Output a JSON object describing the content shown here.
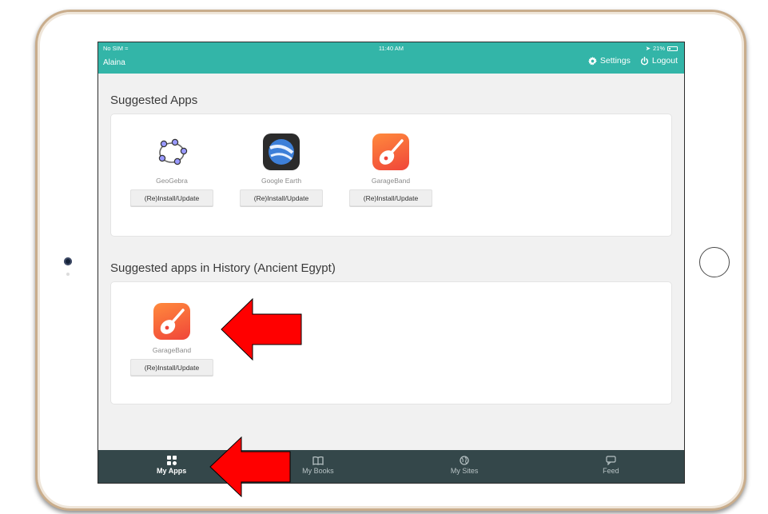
{
  "status_bar": {
    "carrier": "No SIM",
    "time": "11:40 AM",
    "battery": "21%"
  },
  "header": {
    "user_name": "Alaina",
    "settings_label": "Settings",
    "logout_label": "Logout"
  },
  "sections": [
    {
      "title": "Suggested Apps",
      "apps": [
        {
          "name": "GeoGebra",
          "icon": "geogebra-icon",
          "button": "(Re)Install/Update"
        },
        {
          "name": "Google Earth",
          "icon": "google-earth-icon",
          "button": "(Re)Install/Update"
        },
        {
          "name": "GarageBand",
          "icon": "garageband-icon",
          "button": "(Re)Install/Update"
        }
      ]
    },
    {
      "title": "Suggested apps in History (Ancient Egypt)",
      "apps": [
        {
          "name": "GarageBand",
          "icon": "garageband-icon",
          "button": "(Re)Install/Update"
        }
      ]
    }
  ],
  "tabs": [
    {
      "label": "My Apps",
      "icon": "apps-grid-icon",
      "active": true
    },
    {
      "label": "My Books",
      "icon": "book-icon",
      "active": false
    },
    {
      "label": "My Sites",
      "icon": "globe-icon",
      "active": false
    },
    {
      "label": "Feed",
      "icon": "chat-icon",
      "active": false
    }
  ],
  "colors": {
    "header_bg": "#33b5a8",
    "tabbar_bg": "#34474a",
    "arrow_red": "#ff0000",
    "frame_gold": "#c9ad8c"
  }
}
